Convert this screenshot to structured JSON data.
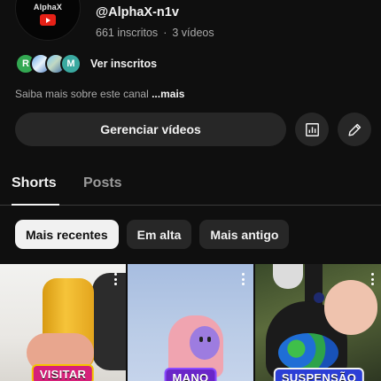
{
  "channel": {
    "avatar_text": "AlphaX",
    "handle": "@AlphaX-n1v",
    "subscribers": "661 inscritos",
    "separator": "·",
    "videos": "3 vídeos",
    "subscriber_faces": [
      "R",
      "",
      "",
      "M"
    ],
    "view_subscribers_label": "Ver inscritos",
    "about_text": "Saiba mais sobre este canal",
    "about_more": "...mais"
  },
  "actions": {
    "manage_label": "Gerenciar vídeos",
    "analytics_icon": "analytics-icon",
    "edit_icon": "pencil-icon"
  },
  "tabs": [
    {
      "label": "Shorts",
      "active": true
    },
    {
      "label": "Posts",
      "active": false
    }
  ],
  "chips": [
    {
      "label": "Mais recentes",
      "active": true
    },
    {
      "label": "Em alta",
      "active": false
    },
    {
      "label": "Mais antigo",
      "active": false
    }
  ],
  "shorts": [
    {
      "caption": "VISITAR"
    },
    {
      "caption": "MANO"
    },
    {
      "caption": "SUSPENSÃO"
    }
  ],
  "colors": {
    "background": "#0f0f0f",
    "chip_bg": "#272727",
    "chip_active_bg": "#f1f1f1",
    "secondary_text": "#aaaaaa"
  }
}
